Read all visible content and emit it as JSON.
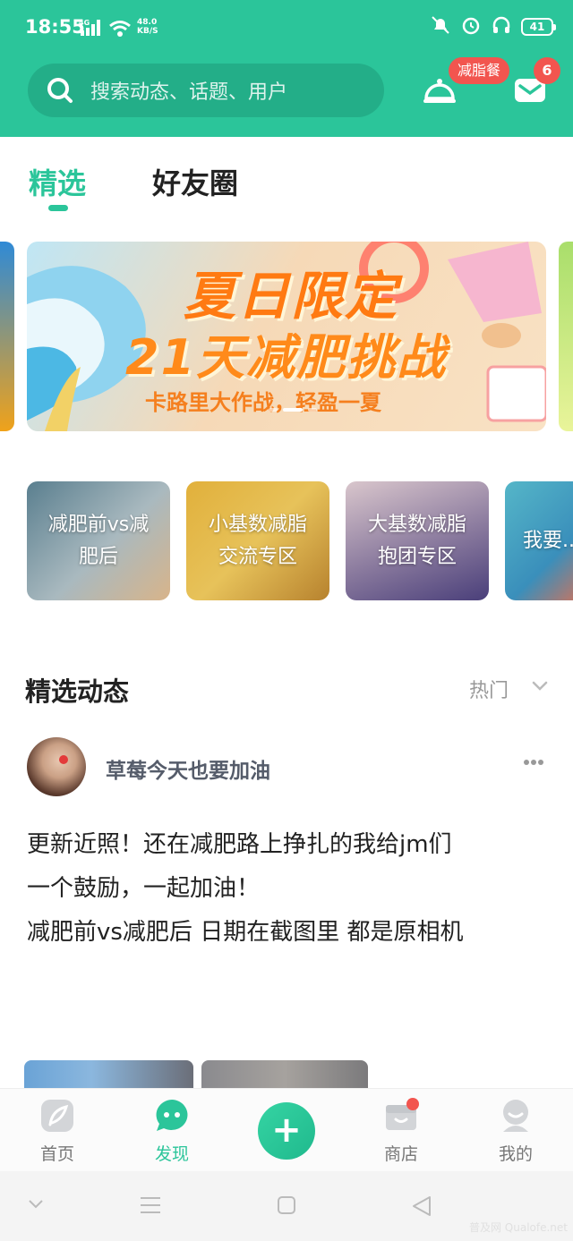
{
  "status": {
    "time": "18:55",
    "network": "4G",
    "speed_value": "48.0",
    "speed_unit": "KB/S",
    "battery": "41"
  },
  "search": {
    "placeholder": "搜索动态、话题、用户"
  },
  "header": {
    "meal_badge": "减脂餐",
    "mail_count": "6"
  },
  "tabs": [
    {
      "label": "精选"
    },
    {
      "label": "好友圈"
    }
  ],
  "banner": {
    "title": "夏日限定",
    "headline": "21天减肥挑战",
    "subtitle": "卡路里大作战，轻盈一夏"
  },
  "categories": [
    {
      "line1": "减肥前vs减",
      "line2": "肥后"
    },
    {
      "line1": "小基数减脂",
      "line2": "交流专区"
    },
    {
      "line1": "大基数减脂",
      "line2": "抱团专区"
    },
    {
      "line1": "我要..."
    }
  ],
  "feed": {
    "title": "精选动态",
    "sort_label": "热门",
    "post": {
      "username": "草莓今天也要加油",
      "lines": [
        "更新近照！还在减肥路上挣扎的我给jm们",
        "一个鼓励，一起加油！",
        "减肥前vs减肥后 日期在截图里 都是原相机"
      ]
    }
  },
  "nav": [
    {
      "label": "首页"
    },
    {
      "label": "发现"
    },
    {
      "label": "+"
    },
    {
      "label": "商店"
    },
    {
      "label": "我的"
    }
  ],
  "colors": {
    "brand": "#2bc59a",
    "badge": "#f2554f"
  },
  "watermark": "普及网 Qualofe.net"
}
